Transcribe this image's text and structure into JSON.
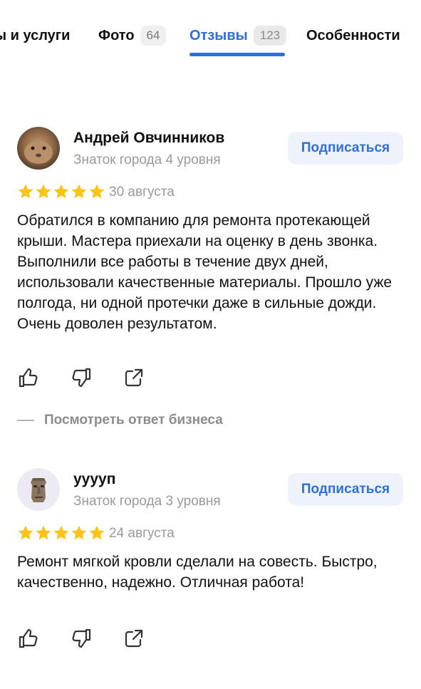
{
  "tabs": [
    {
      "label": "ы и услуги"
    },
    {
      "label": "Фото",
      "count": "64"
    },
    {
      "label": "Отзывы",
      "count": "123"
    },
    {
      "label": "Особенности"
    }
  ],
  "colors": {
    "accent": "#2f6fd6",
    "star": "#fcc419",
    "muted": "#9a9a9a"
  },
  "reviews": [
    {
      "author": "Андрей Овчинников",
      "level": "Знаток города 4 уровня",
      "subscribe_label": "Подписаться",
      "rating": 5,
      "date": "30 августа",
      "text": "Обратился в компанию для ремонта протекающей крыши. Мастера приехали на оценку в день звонка. Выполнили все работы в течение двух дней, использовали качественные материалы. Прошло уже полгода, ни одной протечки даже в сильные дожди. Очень доволен результатом.",
      "business_reply_label": "Посмотреть ответ бизнеса"
    },
    {
      "author": "ууууп",
      "level": "Знаток города 3 уровня",
      "subscribe_label": "Подписаться",
      "rating": 5,
      "date": "24 августа",
      "text": "Ремонт мягкой кровли сделали на совесть. Быстро, качественно, надежно. Отличная работа!"
    }
  ]
}
